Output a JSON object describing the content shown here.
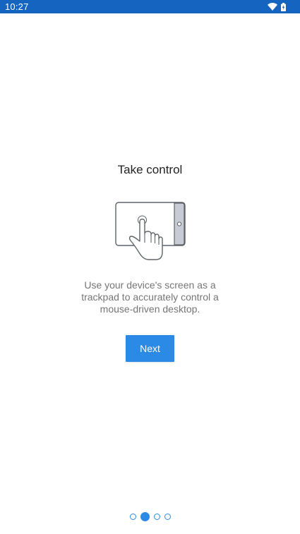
{
  "status_bar": {
    "time": "10:27",
    "icons": [
      "wifi-icon",
      "battery-icon"
    ],
    "background": "#1565c0"
  },
  "onboarding": {
    "title": "Take control",
    "illustration": "tablet-touch-icon",
    "description": "Use your device's screen as a trackpad to accurately control a mouse-driven desktop.",
    "next_label": "Next",
    "accent": "#2b8ae6"
  },
  "pager": {
    "total_pages": 4,
    "current_page": 2
  }
}
